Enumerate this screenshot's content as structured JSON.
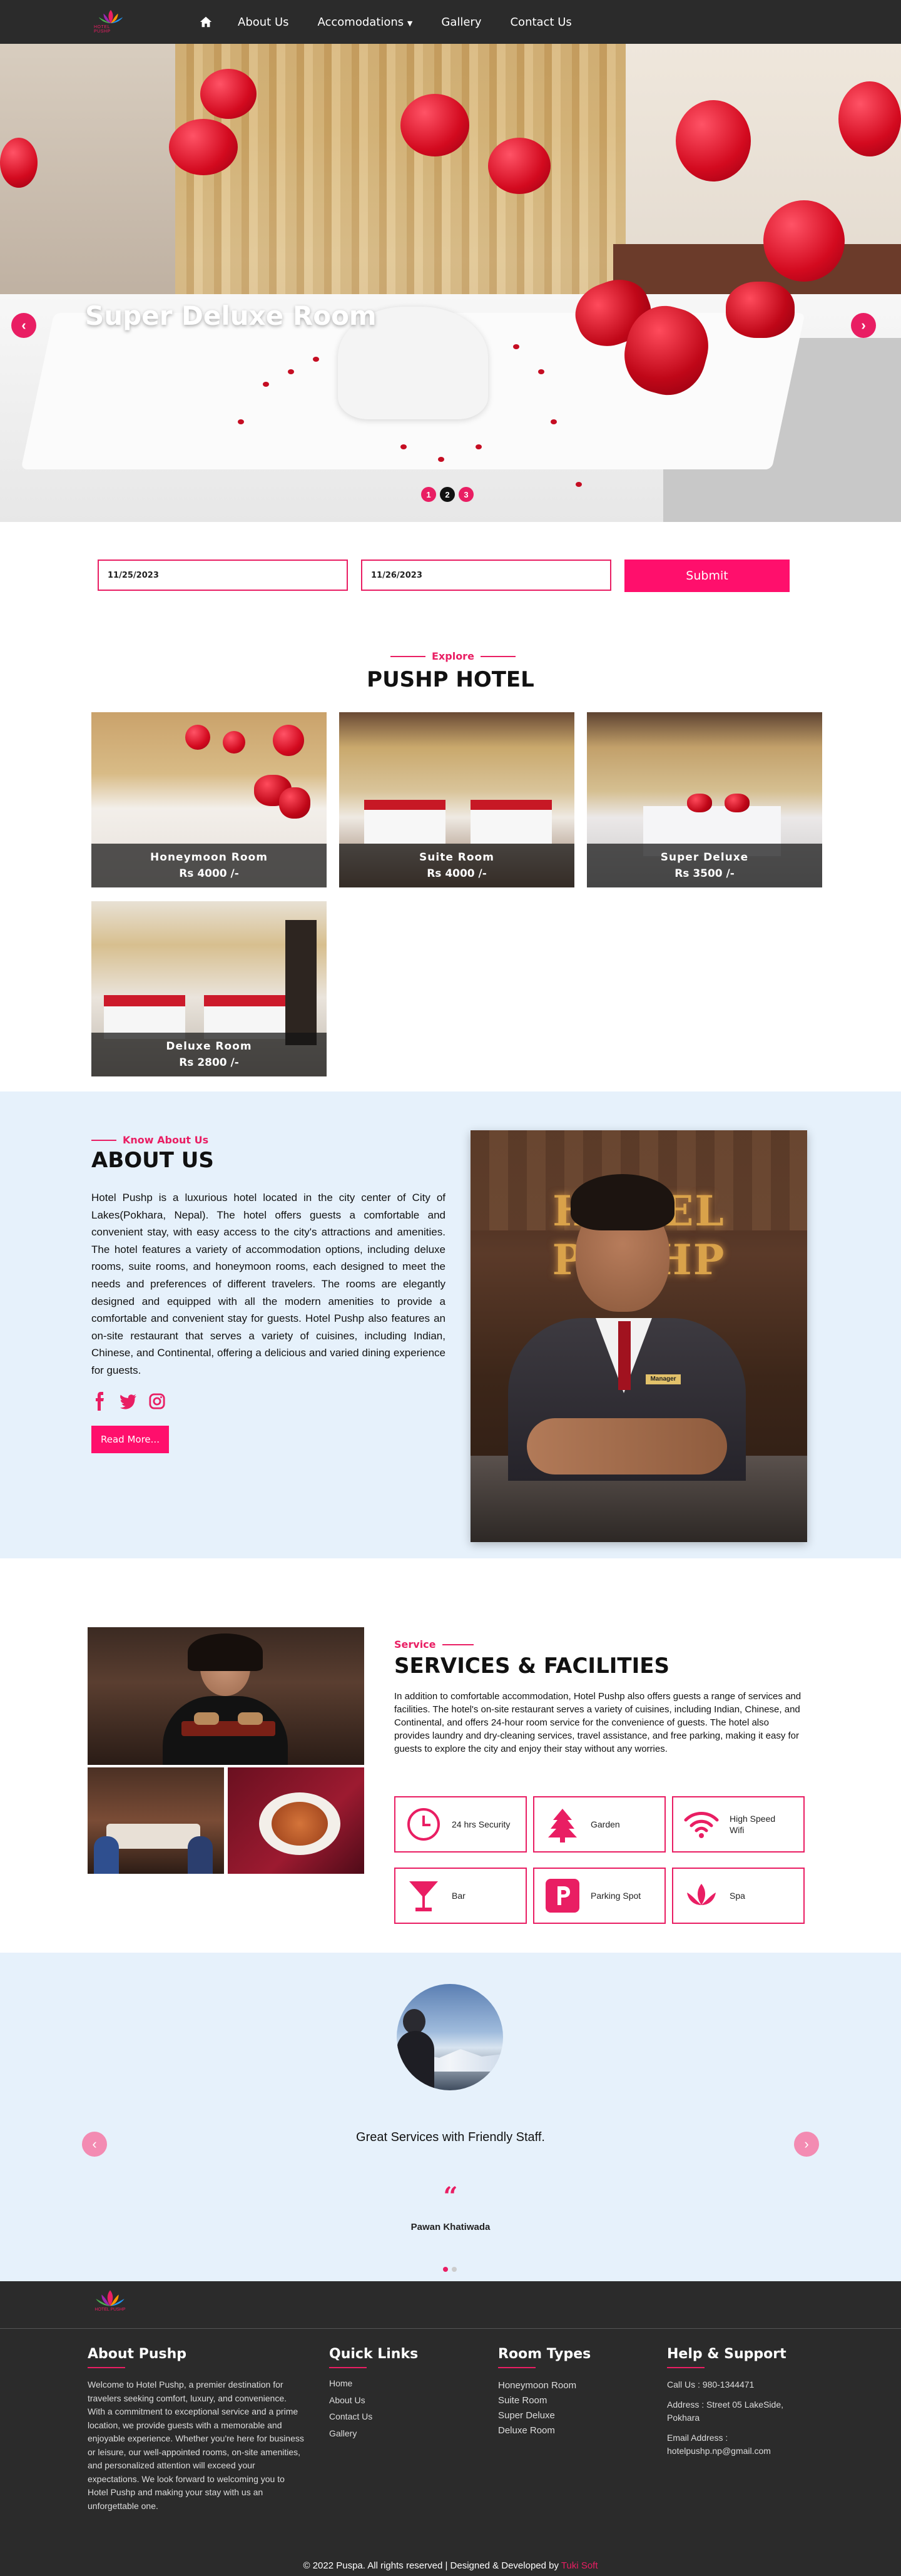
{
  "nav": {
    "logo_text": "HOTEL PUSHP",
    "links": [
      "About Us",
      "Accomodations",
      "Gallery",
      "Contact Us"
    ],
    "icons": {
      "home": "home-icon",
      "dropdown": "caret-down-icon"
    }
  },
  "hero": {
    "title": "Super Deluxe Room",
    "dots": [
      "1",
      "2",
      "3"
    ],
    "active_dot": 2
  },
  "booking": {
    "checkin": "11/25/2023",
    "checkout": "11/26/2023",
    "submit": "Submit"
  },
  "explore": {
    "eyebrow": "Explore",
    "heading": "PUSHP HOTEL",
    "rooms": [
      {
        "name": "Honeymoon Room",
        "price": "Rs 4000 /-"
      },
      {
        "name": "Suite Room",
        "price": "Rs 4000 /-"
      },
      {
        "name": "Super Deluxe",
        "price": "Rs 3500 /-"
      },
      {
        "name": "Deluxe Room",
        "price": "Rs 2800 /-"
      }
    ]
  },
  "about": {
    "eyebrow": "Know About Us",
    "heading": "ABOUT US",
    "text": "Hotel Pushp is a luxurious hotel located in the city center of City of Lakes(Pokhara, Nepal). The hotel offers guests a comfortable and convenient stay, with easy access to the city's attractions and amenities. The hotel features a variety of accommodation options, including deluxe rooms, suite rooms, and honeymoon rooms, each designed to meet the needs and preferences of different travelers. The rooms are elegantly designed and equipped with all the modern amenities to provide a comfortable and convenient stay for guests. Hotel Pushp also features an on-site restaurant that serves a variety of cuisines, including Indian, Chinese, and Continental, offering a delicious and varied dining experience for guests.",
    "social": [
      "facebook-icon",
      "twitter-icon",
      "instagram-icon"
    ],
    "read_more": "Read More...",
    "image_sign_top": "HOTEL PUSHP",
    "badge": "Manager"
  },
  "services": {
    "eyebrow": "Service",
    "heading": "SERVICES & FACILITIES",
    "text": "In addition to comfortable accommodation, Hotel Pushp also offers guests a range of services and facilities. The hotel's on-site restaurant serves a variety of cuisines, including Indian, Chinese, and Continental, and offers 24-hour room service for the convenience of guests. The hotel also provides laundry and dry-cleaning services, travel assistance, and free parking, making it easy for guests to explore the city and enjoy their stay without any worries.",
    "facilities": [
      {
        "label": "24 hrs Security",
        "icon": "clock-icon"
      },
      {
        "label": "Garden",
        "icon": "tree-icon"
      },
      {
        "label": "High Speed Wifi",
        "icon": "wifi-icon"
      },
      {
        "label": "Bar",
        "icon": "cocktail-icon"
      },
      {
        "label": "Parking Spot",
        "icon": "parking-icon"
      },
      {
        "label": "Spa",
        "icon": "lotus-icon"
      }
    ]
  },
  "testimonial": {
    "quote": "Great Services with Friendly Staff.",
    "mark": "“",
    "name": "Pawan Khatiwada"
  },
  "footer": {
    "about_title": "About Pushp",
    "about_text": "Welcome to Hotel Pushp, a premier destination for travelers seeking comfort, luxury, and convenience. With a commitment to exceptional service and a prime location, we provide guests with a memorable and enjoyable experience. Whether you're here for business or leisure, our well-appointed rooms, on-site amenities, and personalized attention will exceed your expectations. We look forward to welcoming you to Hotel Pushp and making your stay with us an unforgettable one.",
    "quick_title": "Quick Links",
    "quick_links": [
      "Home",
      "About Us",
      "Contact Us",
      "Gallery"
    ],
    "rooms_title": "Room Types",
    "room_types": [
      "Honeymoon Room",
      "Suite Room",
      "Super Deluxe",
      "Deluxe Room"
    ],
    "help_title": "Help & Support",
    "call": "Call Us : 980-1344471",
    "address": "Address : Street 05 LakeSide, Pokhara",
    "email_label": "Email Address :",
    "email": "hotelpushp.np@gmail.com",
    "copyright": "© 2022 Puspa. All rights reserved | Designed & Developed by",
    "developer": "Tuki Soft"
  },
  "colors": {
    "accent": "#e91e63",
    "button": "#ff0f6c",
    "dark": "#2b2b2b",
    "light_bg": "#e6f1fb"
  }
}
